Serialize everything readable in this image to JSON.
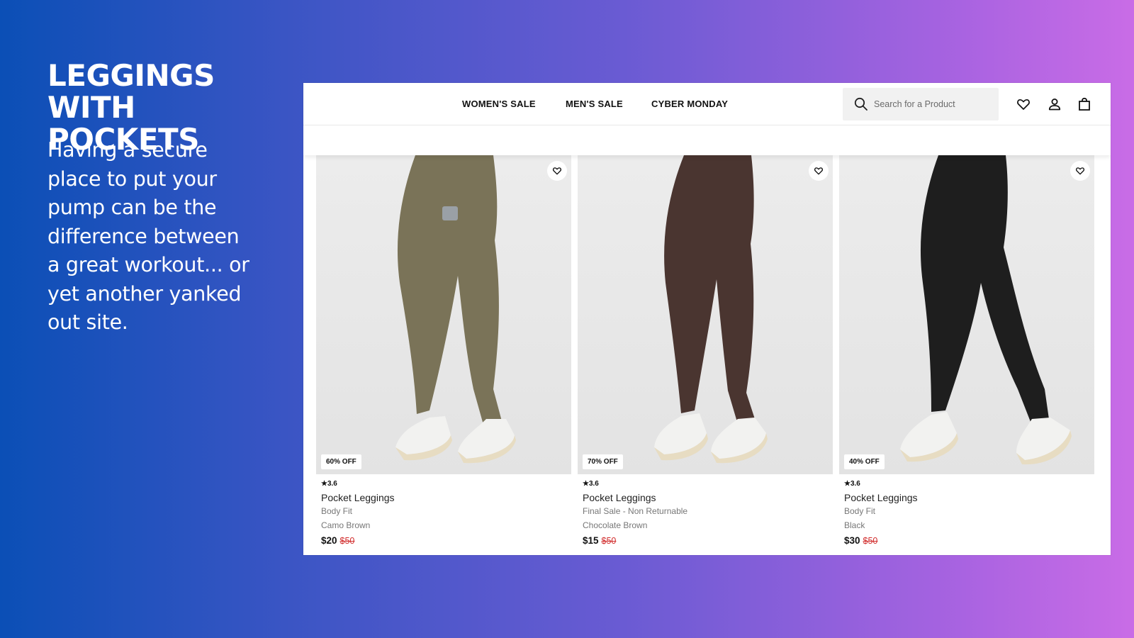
{
  "slide": {
    "headline_line1": "LEGGINGS",
    "headline_line2": "WITH POCKETS",
    "body_lines": [
      "Having a secure",
      "place to put your",
      "pump can be the",
      "difference between",
      "a great workout... or",
      "yet another yanked",
      "out site."
    ]
  },
  "nav": {
    "links": [
      "WOMEN'S SALE",
      "MEN'S SALE",
      "CYBER MONDAY"
    ],
    "search_placeholder": "Search for a Product"
  },
  "products": [
    {
      "badge": "60% OFF",
      "rating": "3.6",
      "name": "Pocket Leggings",
      "fit": "Body Fit",
      "color_name": "Camo Brown",
      "price": "$20",
      "was_price": "$50",
      "legging_color": "#7a7358"
    },
    {
      "badge": "70% OFF",
      "rating": "3.6",
      "name": "Pocket Leggings",
      "fit": "Final Sale - Non Returnable",
      "color_name": "Chocolate Brown",
      "price": "$15",
      "was_price": "$50",
      "legging_color": "#4a3530"
    },
    {
      "badge": "40% OFF",
      "rating": "3.6",
      "name": "Pocket Leggings",
      "fit": "Body Fit",
      "color_name": "Black",
      "price": "$30",
      "was_price": "$50",
      "legging_color": "#1e1e1e"
    }
  ],
  "colors": {
    "gradient_left": "#0b4fb6",
    "gradient_right": "#c96ce6",
    "sale_red": "#d12c2c"
  },
  "icons": [
    "search-icon",
    "heart-icon",
    "user-icon",
    "bag-icon"
  ]
}
